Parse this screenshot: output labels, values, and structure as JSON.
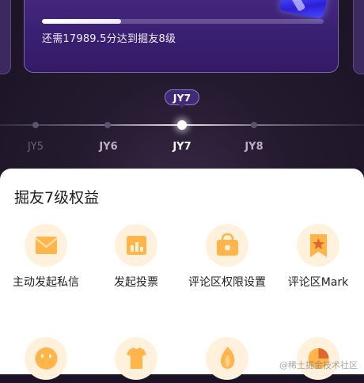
{
  "progress": {
    "fraction": 0.28,
    "text": "还需17989.5分达到掘友8级"
  },
  "levels": {
    "current_tag": "JY7",
    "items": [
      "JY5",
      "JY6",
      "JY7",
      "JY8"
    ],
    "current_index": 2
  },
  "benefits": {
    "title": "掘友7级权益",
    "items": [
      {
        "label": "主动发起私信",
        "icon": "envelope-icon"
      },
      {
        "label": "发起投票",
        "icon": "vote-chart-icon"
      },
      {
        "label": "评论区权限设置",
        "icon": "shop-bag-icon"
      },
      {
        "label": "评论区Mark",
        "icon": "bookmark-star-icon"
      },
      {
        "label": "",
        "icon": "emoji-face-icon"
      },
      {
        "label": "",
        "icon": "shirt-icon"
      },
      {
        "label": "",
        "icon": "flame-icon"
      },
      {
        "label": "",
        "icon": "pie-chart-icon"
      }
    ]
  },
  "watermark": "@稀土掘金技术社区",
  "colors": {
    "icon_bg": "#fff1dc",
    "icon_orange": "#ffb54a",
    "card_purple": "#3a2072"
  }
}
